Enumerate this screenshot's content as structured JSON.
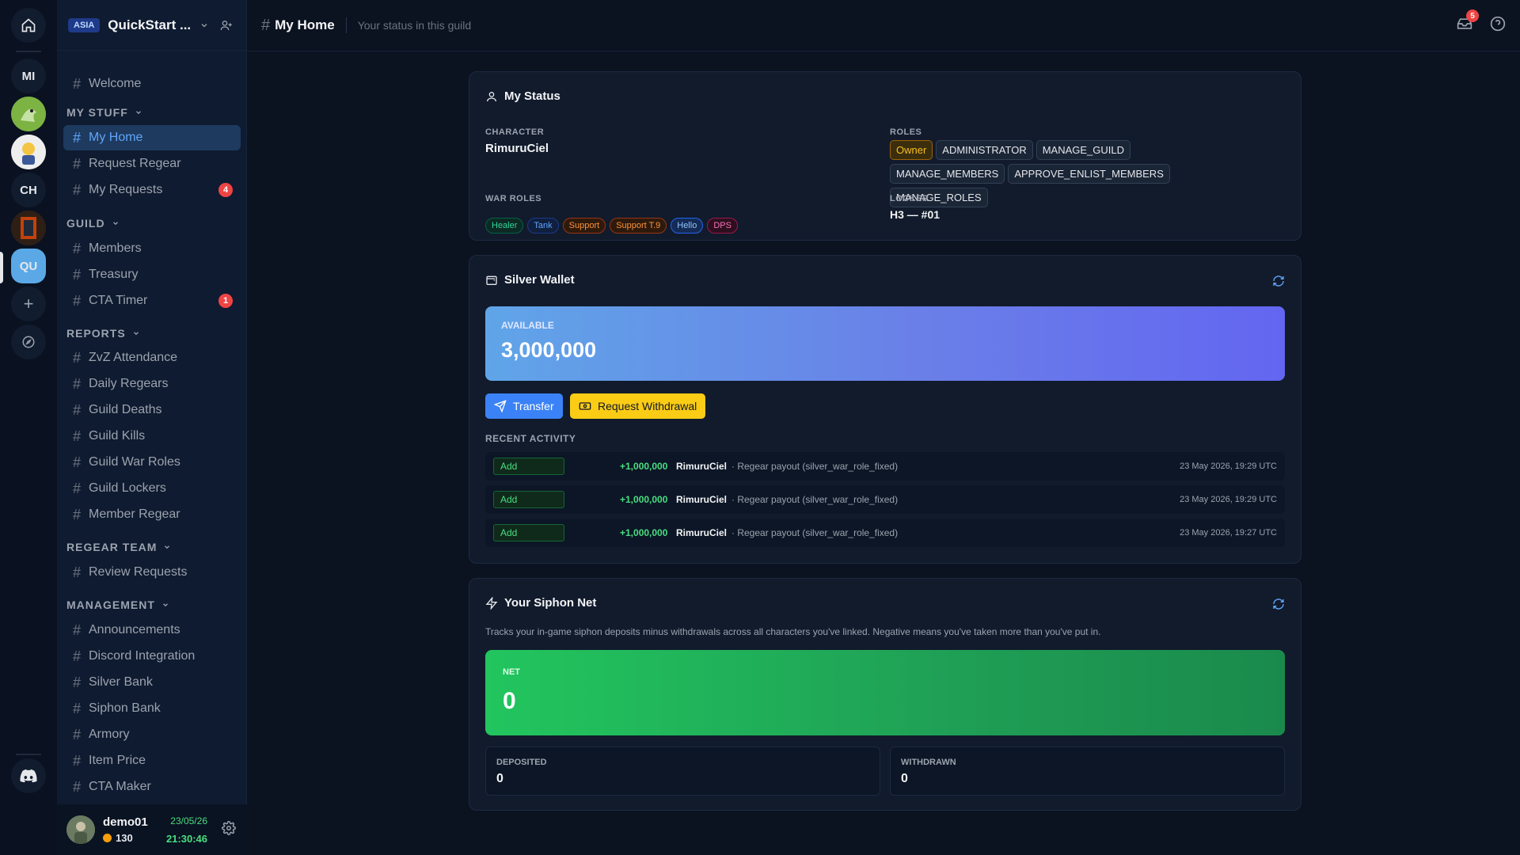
{
  "rail": {
    "items": [
      {
        "label": "MI"
      },
      {
        "label": "CH"
      },
      {
        "label": "QU"
      }
    ]
  },
  "guild": {
    "region": "ASIA",
    "name": "QuickStart ..."
  },
  "sidebar": {
    "top": [
      {
        "label": "Welcome"
      }
    ],
    "categories": {
      "my_stuff": "MY STUFF",
      "guild": "GUILD",
      "reports": "REPORTS",
      "regear_team": "REGEAR TEAM",
      "management": "MANAGEMENT"
    },
    "my_stuff": [
      {
        "label": "My Home"
      },
      {
        "label": "Request Regear"
      },
      {
        "label": "My Requests",
        "badge": "4"
      }
    ],
    "guild": [
      {
        "label": "Members"
      },
      {
        "label": "Treasury"
      },
      {
        "label": "CTA Timer",
        "badge": "1"
      }
    ],
    "reports": [
      {
        "label": "ZvZ Attendance"
      },
      {
        "label": "Daily Regears"
      },
      {
        "label": "Guild Deaths"
      },
      {
        "label": "Guild Kills"
      },
      {
        "label": "Guild War Roles"
      },
      {
        "label": "Guild Lockers"
      },
      {
        "label": "Member Regear"
      }
    ],
    "regear_team": [
      {
        "label": "Review Requests"
      }
    ],
    "management": [
      {
        "label": "Announcements"
      },
      {
        "label": "Discord Integration"
      },
      {
        "label": "Silver Bank"
      },
      {
        "label": "Siphon Bank"
      },
      {
        "label": "Armory"
      },
      {
        "label": "Item Price"
      },
      {
        "label": "CTA Maker"
      }
    ]
  },
  "user": {
    "name": "demo01",
    "points": "130",
    "date": "23/05/26",
    "time": "21:30:46"
  },
  "header": {
    "title": "My Home",
    "subtitle": "Your status in this guild",
    "inbox_count": "5"
  },
  "status": {
    "title": "My Status",
    "character_label": "CHARACTER",
    "character": "RimuruCiel",
    "roles_label": "ROLES",
    "roles": [
      "Owner",
      "ADMINISTRATOR",
      "MANAGE_GUILD",
      "MANAGE_MEMBERS",
      "APPROVE_ENLIST_MEMBERS",
      "MANAGE_ROLES"
    ],
    "war_roles_label": "WAR ROLES",
    "war_roles": [
      "Healer",
      "Tank",
      "Support",
      "Support T.9",
      "Hello",
      "DPS"
    ],
    "locker_label": "LOCKER",
    "locker": "H3 — #01"
  },
  "wallet": {
    "title": "Silver Wallet",
    "available_label": "AVAILABLE",
    "available": "3,000,000",
    "transfer_label": "Transfer",
    "withdraw_label": "Request Withdrawal",
    "recent_label": "RECENT ACTIVITY",
    "activity": [
      {
        "type": "Add",
        "amount": "+1,000,000",
        "who": "RimuruCiel",
        "desc": "· Regear payout (silver_war_role_fixed)",
        "time": "23 May 2026, 19:29 UTC"
      },
      {
        "type": "Add",
        "amount": "+1,000,000",
        "who": "RimuruCiel",
        "desc": "· Regear payout (silver_war_role_fixed)",
        "time": "23 May 2026, 19:29 UTC"
      },
      {
        "type": "Add",
        "amount": "+1,000,000",
        "who": "RimuruCiel",
        "desc": "· Regear payout (silver_war_role_fixed)",
        "time": "23 May 2026, 19:27 UTC"
      }
    ]
  },
  "siphon": {
    "title": "Your Siphon Net",
    "description": "Tracks your in-game siphon deposits minus withdrawals across all characters you've linked. Negative means you've taken more than you've put in.",
    "net_label": "NET",
    "net": "0",
    "deposited_label": "DEPOSITED",
    "deposited": "0",
    "withdrawn_label": "WITHDRAWN",
    "withdrawn": "0"
  }
}
